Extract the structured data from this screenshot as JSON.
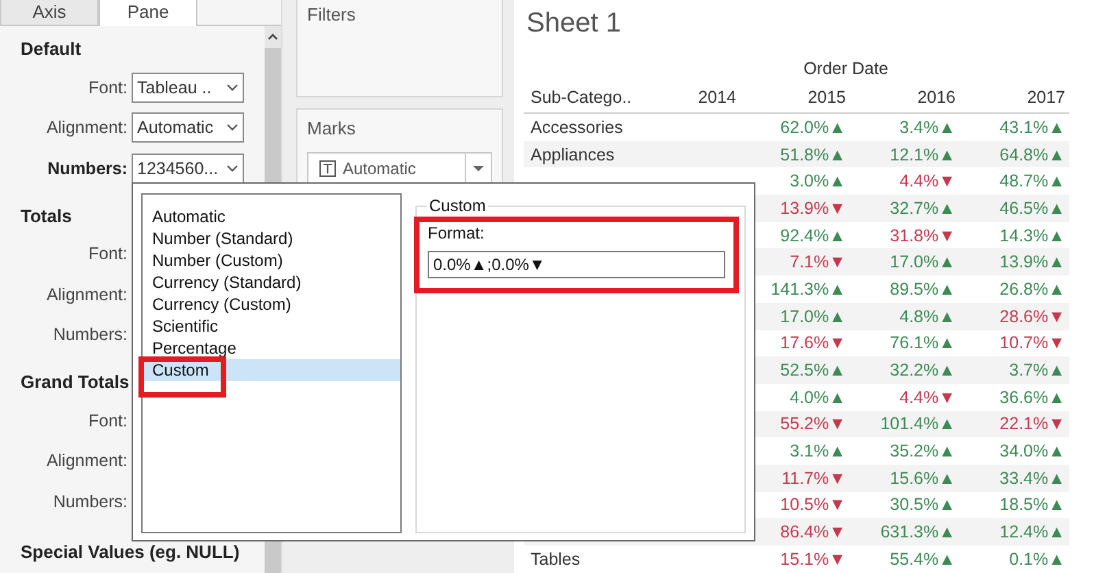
{
  "tabs": [
    {
      "label": "Axis",
      "selected": false
    },
    {
      "label": "Pane",
      "selected": true
    }
  ],
  "format_sections": [
    {
      "title": "Default",
      "fields": [
        {
          "label": "Font:",
          "value": "Tableau ..",
          "emphasized": false
        },
        {
          "label": "Alignment:",
          "value": "Automatic",
          "emphasized": false
        },
        {
          "label": "Numbers:",
          "value": "1234560...",
          "emphasized": true
        }
      ]
    },
    {
      "title": "Totals",
      "fields": [
        {
          "label": "Font:",
          "emphasized": false
        },
        {
          "label": "Alignment:",
          "emphasized": false
        },
        {
          "label": "Numbers:",
          "emphasized": false
        }
      ]
    },
    {
      "title": "Grand Totals",
      "fields": [
        {
          "label": "Font:",
          "emphasized": false
        },
        {
          "label": "Alignment:",
          "emphasized": false
        },
        {
          "label": "Numbers:",
          "emphasized": false
        }
      ]
    },
    {
      "title": "Special Values (eg. NULL)"
    }
  ],
  "shelves": {
    "filters": {
      "title": "Filters"
    },
    "marks": {
      "title": "Marks",
      "mark_type": "Automatic"
    }
  },
  "sheet": {
    "title": "Sheet 1",
    "column_group": "Order Date",
    "columns": [
      "Sub-Catego..",
      "2014",
      "2015",
      "2016",
      "2017"
    ],
    "rows": [
      {
        "cells": [
          {
            "text": "Accessories"
          },
          {
            "text": ""
          },
          {
            "text": "62.0%▲",
            "color": "#3d8a55"
          },
          {
            "text": "3.4%▲",
            "color": "#3d8a55"
          },
          {
            "text": "43.1%▲",
            "color": "#3d8a55"
          }
        ]
      },
      {
        "cells": [
          {
            "text": "Appliances"
          },
          {
            "text": ""
          },
          {
            "text": "51.8%▲",
            "color": "#3d8a55"
          },
          {
            "text": "12.1%▲",
            "color": "#3d8a55"
          },
          {
            "text": "64.8%▲",
            "color": "#3d8a55"
          }
        ]
      },
      {
        "cells": [
          {
            "text": ""
          },
          {
            "text": ""
          },
          {
            "text": "3.0%▲",
            "color": "#3d8a55"
          },
          {
            "text": "4.4%▼",
            "color": "#c33a4e"
          },
          {
            "text": "48.7%▲",
            "color": "#3d8a55"
          }
        ]
      },
      {
        "cells": [
          {
            "text": ""
          },
          {
            "text": ""
          },
          {
            "text": "13.9%▼",
            "color": "#c33a4e"
          },
          {
            "text": "32.7%▲",
            "color": "#3d8a55"
          },
          {
            "text": "46.5%▲",
            "color": "#3d8a55"
          }
        ]
      },
      {
        "cells": [
          {
            "text": ""
          },
          {
            "text": ""
          },
          {
            "text": "92.4%▲",
            "color": "#3d8a55"
          },
          {
            "text": "31.8%▼",
            "color": "#c33a4e"
          },
          {
            "text": "14.3%▲",
            "color": "#3d8a55"
          }
        ]
      },
      {
        "cells": [
          {
            "text": ""
          },
          {
            "text": ""
          },
          {
            "text": "7.1%▼",
            "color": "#c33a4e"
          },
          {
            "text": "17.0%▲",
            "color": "#3d8a55"
          },
          {
            "text": "13.9%▲",
            "color": "#3d8a55"
          }
        ]
      },
      {
        "cells": [
          {
            "text": ""
          },
          {
            "text": ""
          },
          {
            "text": "141.3%▲",
            "color": "#3d8a55"
          },
          {
            "text": "89.5%▲",
            "color": "#3d8a55"
          },
          {
            "text": "26.8%▲",
            "color": "#3d8a55"
          }
        ]
      },
      {
        "cells": [
          {
            "text": ""
          },
          {
            "text": ""
          },
          {
            "text": "17.0%▲",
            "color": "#3d8a55"
          },
          {
            "text": "4.8%▲",
            "color": "#3d8a55"
          },
          {
            "text": "28.6%▼",
            "color": "#c33a4e"
          }
        ]
      },
      {
        "cells": [
          {
            "text": ""
          },
          {
            "text": ""
          },
          {
            "text": "17.6%▼",
            "color": "#c33a4e"
          },
          {
            "text": "76.1%▲",
            "color": "#3d8a55"
          },
          {
            "text": "10.7%▼",
            "color": "#c33a4e"
          }
        ]
      },
      {
        "cells": [
          {
            "text": ""
          },
          {
            "text": ""
          },
          {
            "text": "52.5%▲",
            "color": "#3d8a55"
          },
          {
            "text": "32.2%▲",
            "color": "#3d8a55"
          },
          {
            "text": "3.7%▲",
            "color": "#3d8a55"
          }
        ]
      },
      {
        "cells": [
          {
            "text": ""
          },
          {
            "text": ""
          },
          {
            "text": "4.0%▲",
            "color": "#3d8a55"
          },
          {
            "text": "4.4%▼",
            "color": "#c33a4e"
          },
          {
            "text": "36.6%▲",
            "color": "#3d8a55"
          }
        ]
      },
      {
        "cells": [
          {
            "text": ""
          },
          {
            "text": ""
          },
          {
            "text": "55.2%▼",
            "color": "#c33a4e"
          },
          {
            "text": "101.4%▲",
            "color": "#3d8a55"
          },
          {
            "text": "22.1%▼",
            "color": "#c33a4e"
          }
        ]
      },
      {
        "cells": [
          {
            "text": ""
          },
          {
            "text": ""
          },
          {
            "text": "3.1%▲",
            "color": "#3d8a55"
          },
          {
            "text": "35.2%▲",
            "color": "#3d8a55"
          },
          {
            "text": "34.0%▲",
            "color": "#3d8a55"
          }
        ]
      },
      {
        "cells": [
          {
            "text": ""
          },
          {
            "text": ""
          },
          {
            "text": "11.7%▼",
            "color": "#c33a4e"
          },
          {
            "text": "15.6%▲",
            "color": "#3d8a55"
          },
          {
            "text": "33.4%▲",
            "color": "#3d8a55"
          }
        ]
      },
      {
        "cells": [
          {
            "text": ""
          },
          {
            "text": ""
          },
          {
            "text": "10.5%▼",
            "color": "#c33a4e"
          },
          {
            "text": "30.5%▲",
            "color": "#3d8a55"
          },
          {
            "text": "18.5%▲",
            "color": "#3d8a55"
          }
        ]
      },
      {
        "cells": [
          {
            "text": ""
          },
          {
            "text": ""
          },
          {
            "text": "86.4%▼",
            "color": "#c33a4e"
          },
          {
            "text": "631.3%▲",
            "color": "#3d8a55"
          },
          {
            "text": "12.4%▲",
            "color": "#3d8a55"
          }
        ]
      },
      {
        "cells": [
          {
            "text": "Tables"
          },
          {
            "text": ""
          },
          {
            "text": "15.1%▼",
            "color": "#c33a4e"
          },
          {
            "text": "55.4%▲",
            "color": "#3d8a55"
          },
          {
            "text": "0.1%▲",
            "color": "#3d8a55"
          }
        ]
      }
    ]
  },
  "number_format_popup": {
    "formats": [
      {
        "label": "Automatic",
        "selected": false
      },
      {
        "label": "Number (Standard)",
        "selected": false
      },
      {
        "label": "Number (Custom)",
        "selected": false
      },
      {
        "label": "Currency (Standard)",
        "selected": false
      },
      {
        "label": "Currency (Custom)",
        "selected": false
      },
      {
        "label": "Scientific",
        "selected": false
      },
      {
        "label": "Percentage",
        "selected": false
      },
      {
        "label": "Custom",
        "selected": true
      }
    ],
    "custom": {
      "group_title": "Custom",
      "format_label": "Format:",
      "format_value": "0.0%▲;0.0%▼"
    }
  }
}
